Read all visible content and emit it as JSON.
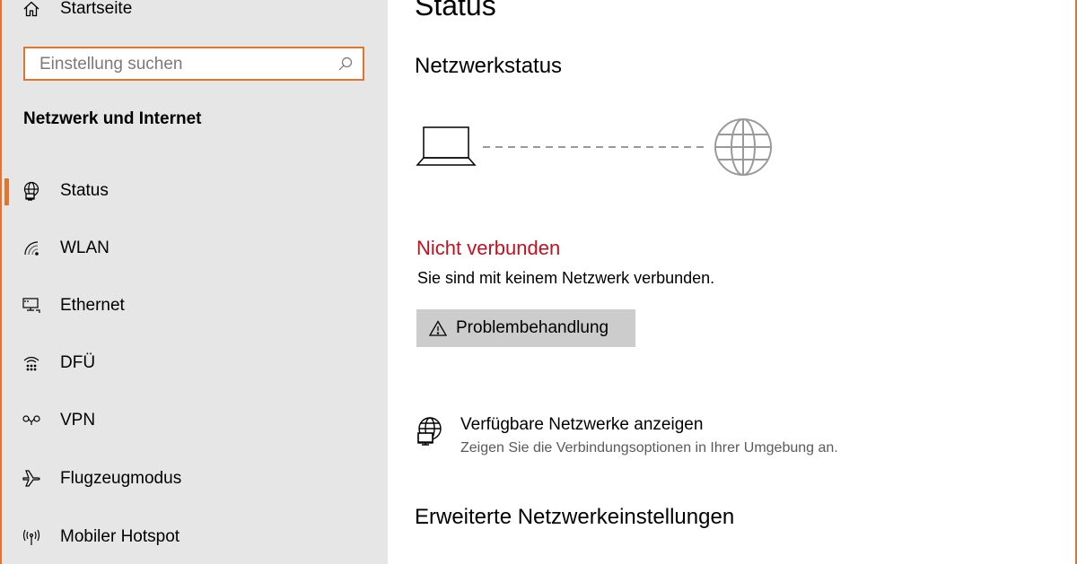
{
  "sidebar": {
    "home_label": "Startseite",
    "search_placeholder": "Einstellung suchen",
    "section_title": "Netzwerk und Internet",
    "items": [
      {
        "label": "Status",
        "icon": "globe-status-icon"
      },
      {
        "label": "WLAN",
        "icon": "wifi-icon"
      },
      {
        "label": "Ethernet",
        "icon": "ethernet-icon"
      },
      {
        "label": "DFÜ",
        "icon": "dialup-icon"
      },
      {
        "label": "VPN",
        "icon": "vpn-icon"
      },
      {
        "label": "Flugzeugmodus",
        "icon": "airplane-icon"
      },
      {
        "label": "Mobiler Hotspot",
        "icon": "hotspot-icon"
      }
    ],
    "selected_index": 0
  },
  "main": {
    "title": "Status",
    "network_status_heading": "Netzwerkstatus",
    "connection_state": "Nicht verbunden",
    "connection_description": "Sie sind mit keinem Netzwerk verbunden.",
    "troubleshoot_label": "Problembehandlung",
    "available_networks": {
      "title": "Verfügbare Netzwerke anzeigen",
      "description": "Zeigen Sie die Verbindungsoptionen in Ihrer Umgebung an."
    },
    "advanced_heading": "Erweiterte Netzwerkeinstellungen"
  },
  "colors": {
    "accent": "#e1752f",
    "error": "#c50f1f",
    "sidebar_bg": "#e6e6e6",
    "button_bg": "#cccccc"
  }
}
